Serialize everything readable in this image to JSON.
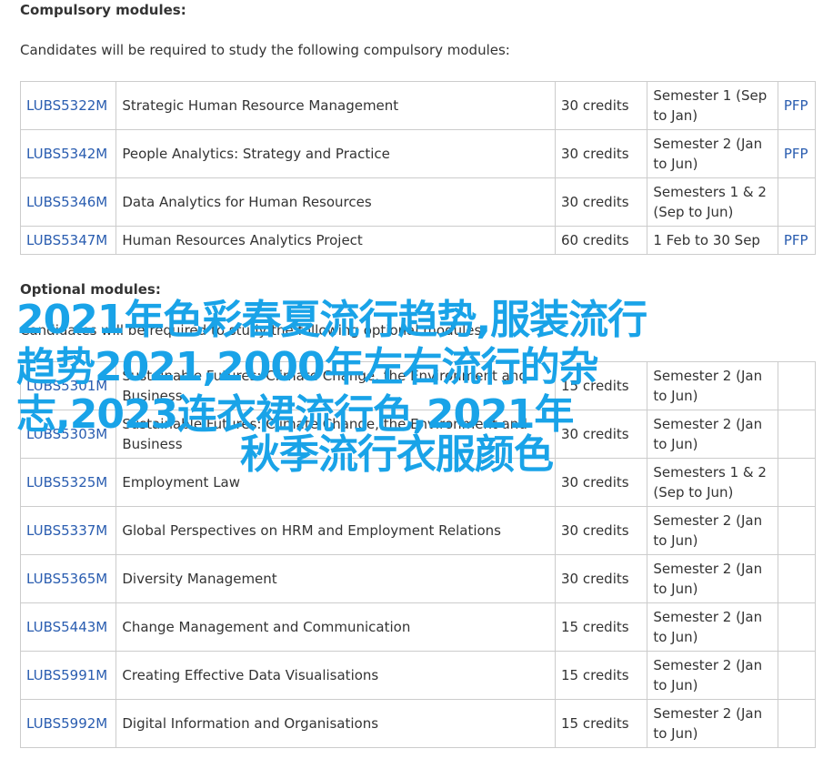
{
  "compulsory": {
    "heading": "Compulsory modules:",
    "intro": "Candidates will be required to study the following compulsory modules:",
    "rows": [
      {
        "code": "LUBS5322M",
        "title": "Strategic Human Resource Management",
        "credits": "30 credits",
        "semester": "Semester 1 (Sep to Jan)",
        "pfp": "PFP"
      },
      {
        "code": "LUBS5342M",
        "title": "People Analytics: Strategy and Practice",
        "credits": "30 credits",
        "semester": "Semester 2 (Jan to Jun)",
        "pfp": "PFP"
      },
      {
        "code": "LUBS5346M",
        "title": "Data Analytics for Human Resources",
        "credits": "30 credits",
        "semester": "Semesters 1 & 2 (Sep to Jun)",
        "pfp": ""
      },
      {
        "code": "LUBS5347M",
        "title": "Human Resources Analytics Project",
        "credits": "60 credits",
        "semester": "1 Feb to 30 Sep",
        "pfp": "PFP"
      }
    ]
  },
  "optional": {
    "heading": "Optional modules:",
    "intro": "Candidates will be required to study the following optional modules:",
    "rows": [
      {
        "code": "LUBS5301M",
        "title": "Sustainable Futures: Climate Change, the Environment and Business",
        "credits": "15 credits",
        "semester": "Semester 2 (Jan to Jun)",
        "pfp": ""
      },
      {
        "code": "LUBS5303M",
        "title": "Sustainable Futures: Climate Change, the Environment and Business",
        "credits": "30 credits",
        "semester": "Semester 2 (Jan to Jun)",
        "pfp": ""
      },
      {
        "code": "LUBS5325M",
        "title": "Employment Law",
        "credits": "30 credits",
        "semester": "Semesters 1 & 2 (Sep to Jun)",
        "pfp": ""
      },
      {
        "code": "LUBS5337M",
        "title": "Global Perspectives on HRM and Employment Relations",
        "credits": "30 credits",
        "semester": "Semester 2 (Jan to Jun)",
        "pfp": ""
      },
      {
        "code": "LUBS5365M",
        "title": "Diversity Management",
        "credits": "30 credits",
        "semester": "Semester 2 (Jan to Jun)",
        "pfp": ""
      },
      {
        "code": "LUBS5443M",
        "title": "Change Management and Communication",
        "credits": "15 credits",
        "semester": "Semester 2 (Jan to Jun)",
        "pfp": ""
      },
      {
        "code": "LUBS5991M",
        "title": "Creating Effective Data Visualisations",
        "credits": "15 credits",
        "semester": "Semester 2 (Jan to Jun)",
        "pfp": ""
      },
      {
        "code": "LUBS5992M",
        "title": "Digital Information and Organisations",
        "credits": "15 credits",
        "semester": "Semester 2 (Jan to Jun)",
        "pfp": ""
      }
    ]
  },
  "overlay": {
    "line1": "2021年色彩春夏流行趋势,服装流行",
    "line2": "趋势2021,2000年左右流行的杂",
    "line3": "志,2023连衣裙流行色,2021年",
    "line4": "秋季流行衣服颜色"
  }
}
